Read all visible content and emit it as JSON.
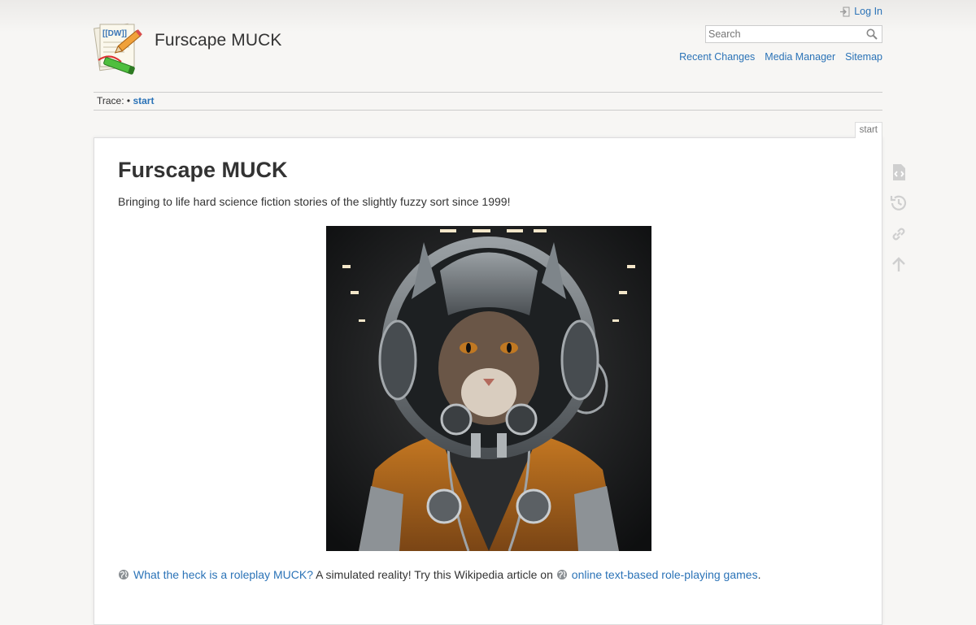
{
  "site": {
    "title": "Furscape MUCK",
    "logo_text": "[[DW]]"
  },
  "user_tools": {
    "login_label": "Log In"
  },
  "search": {
    "placeholder": "Search"
  },
  "site_tools": [
    {
      "label": "Recent Changes"
    },
    {
      "label": "Media Manager"
    },
    {
      "label": "Sitemap"
    }
  ],
  "breadcrumb": {
    "prefix": "Trace:",
    "separator": "•",
    "current": "start"
  },
  "page": {
    "tab_label": "start",
    "heading": "Furscape MUCK",
    "tagline": "Bringing to life hard science fiction stories of the slightly fuzzy sort since 1999!",
    "image_alt": "cat-astronaut-illustration",
    "footer": {
      "link1": "What the heck is a roleplay MUCK?",
      "text_mid": " A simulated reality! Try this Wikipedia article on ",
      "link2": "online text-based role-playing games",
      "text_end": "."
    }
  },
  "page_tools": [
    {
      "icon": "show-source-icon"
    },
    {
      "icon": "old-revisions-icon"
    },
    {
      "icon": "backlinks-icon"
    },
    {
      "icon": "back-to-top-icon"
    }
  ],
  "colors": {
    "link": "#2b73b7",
    "background": "#f7f6f4",
    "text": "#333333",
    "icon_gray": "#cccccc"
  }
}
